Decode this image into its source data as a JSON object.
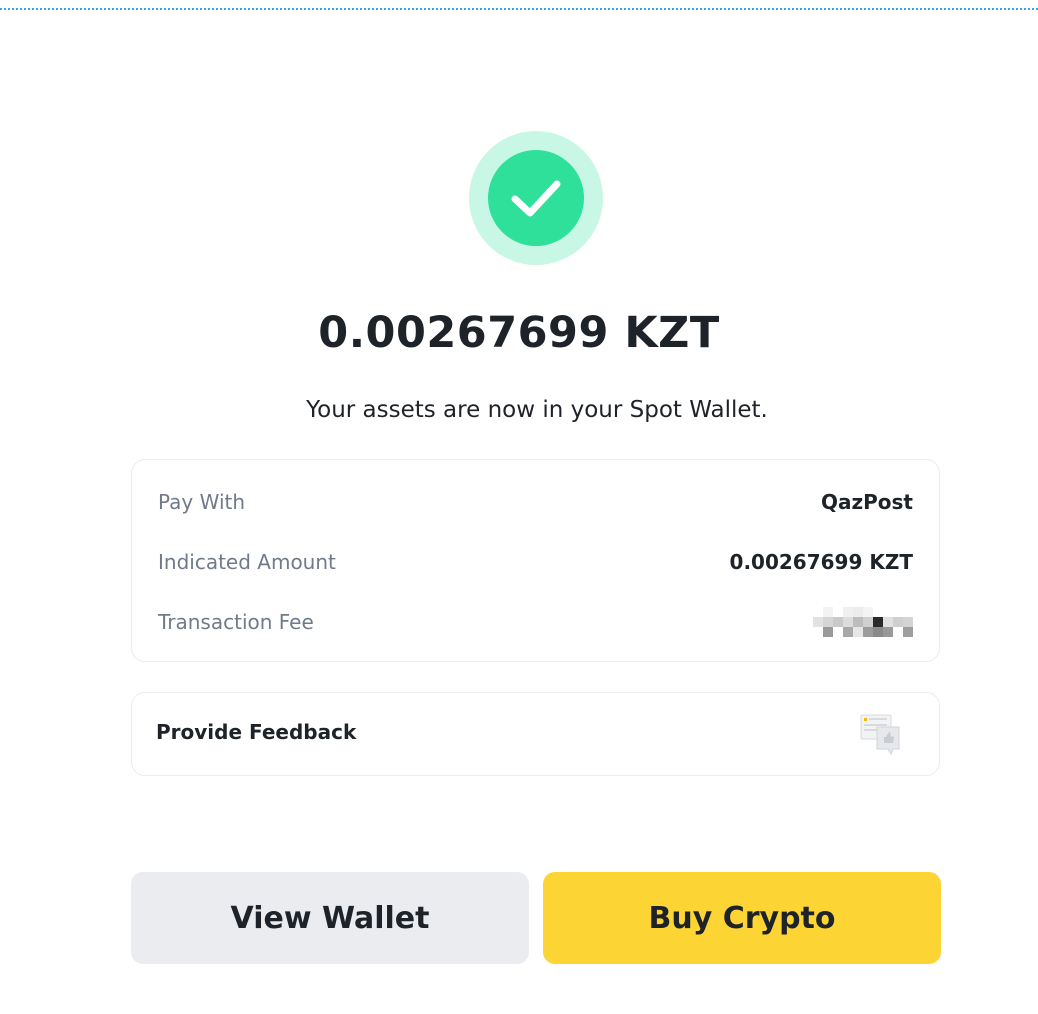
{
  "status": {
    "icon": "check-icon",
    "color": "#2ee09a",
    "ring_color": "#c8f7e5"
  },
  "amount": "0.00267699 KZT",
  "subtitle": "Your assets are now in your Spot Wallet.",
  "details": {
    "pay_with_label": "Pay With",
    "pay_with_value": "QazPost",
    "indicated_amount_label": "Indicated Amount",
    "indicated_amount_value": "0.00267699 KZT",
    "transaction_fee_label": "Transaction Fee"
  },
  "feedback": {
    "label": "Provide Feedback",
    "icon": "feedback-icon"
  },
  "buttons": {
    "view_wallet": "View Wallet",
    "buy_crypto": "Buy Crypto"
  },
  "colors": {
    "accent": "#fcd535",
    "secondary": "#eaecef",
    "text": "#1e2329",
    "muted": "#707a8a"
  }
}
